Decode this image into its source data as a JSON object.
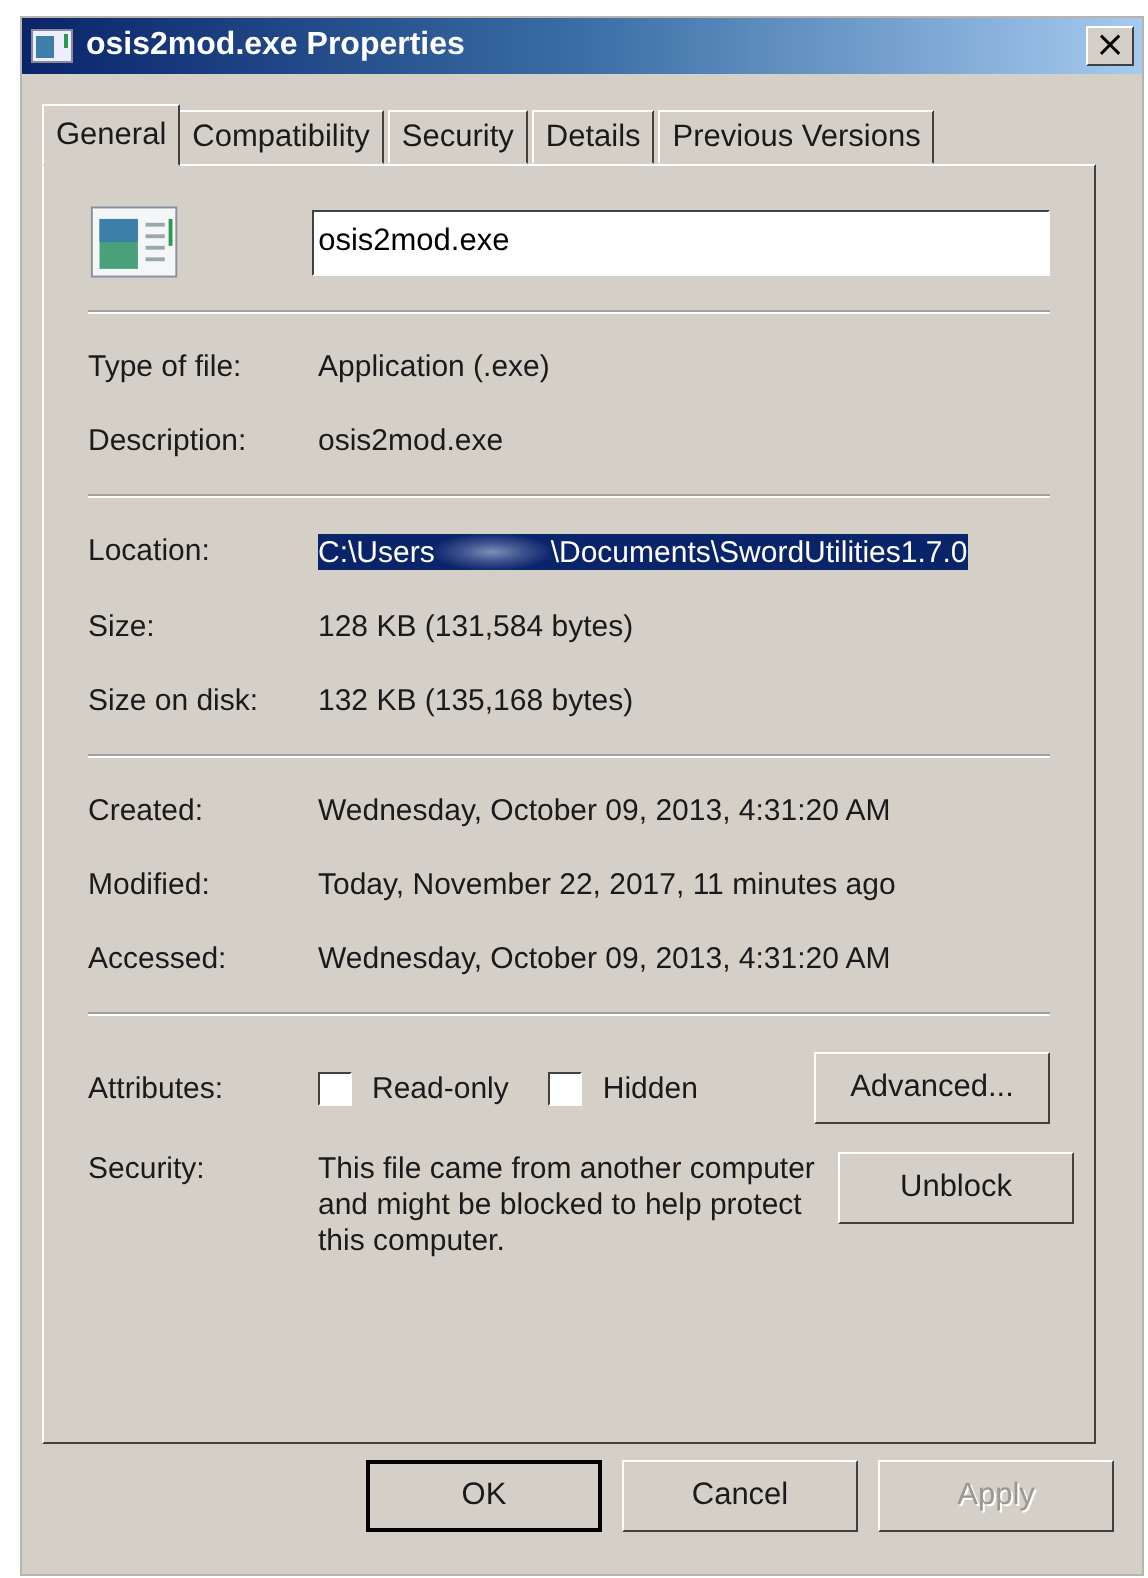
{
  "window": {
    "title": "osis2mod.exe Properties",
    "close": "×"
  },
  "tabs": [
    {
      "label": "General",
      "selected": true
    },
    {
      "label": "Compatibility",
      "selected": false
    },
    {
      "label": "Security",
      "selected": false
    },
    {
      "label": "Details",
      "selected": false
    },
    {
      "label": "Previous Versions",
      "selected": false
    }
  ],
  "file_name": {
    "value": "osis2mod.exe"
  },
  "sections": [
    [
      {
        "label": "Type of file:",
        "value": "Application (.exe)"
      },
      {
        "label": "Description:",
        "value": "osis2mod.exe"
      }
    ],
    [
      {
        "label": "Location:",
        "kind": "selected-path",
        "value": "C:\\Users",
        "value_end": "\\Documents\\SwordUtilities1.7.0"
      },
      {
        "label": "Size:",
        "value": "128 KB (131,584 bytes)"
      },
      {
        "label": "Size on disk:",
        "value": "132 KB (135,168 bytes)"
      }
    ],
    [
      {
        "label": "Created:",
        "value": "Wednesday, October 09, 2013, 4:31:20 AM"
      },
      {
        "label": "Modified:",
        "value": "Today, November 22, 2017, 11 minutes ago"
      },
      {
        "label": "Accessed:",
        "value": "Wednesday, October 09, 2013, 4:31:20 AM"
      }
    ]
  ],
  "attributes": {
    "label": "Attributes:",
    "checkboxes": [
      {
        "label": "Read-only",
        "checked": false
      },
      {
        "label": "Hidden",
        "checked": false
      }
    ],
    "button": "Advanced..."
  },
  "security": {
    "label": "Security:",
    "text": "This file came from another computer and might be blocked to help protect this computer.",
    "button": "Unblock"
  },
  "buttons": [
    {
      "label": "OK",
      "default": true,
      "disabled": false
    },
    {
      "label": "Cancel",
      "default": false,
      "disabled": false
    },
    {
      "label": "Apply",
      "default": false,
      "disabled": true
    }
  ]
}
